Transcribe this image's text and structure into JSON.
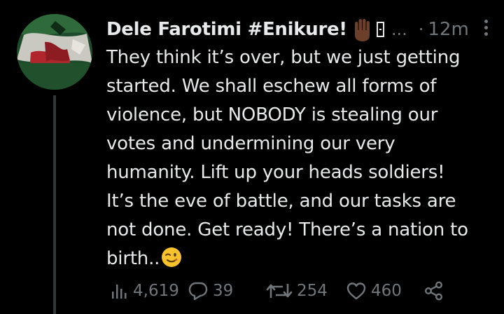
{
  "tweet": {
    "author_name": "Dele Farotimi #Enikure!",
    "ellipsis": "...",
    "separator": "·",
    "timestamp": "12m",
    "text_lines": [
      "They think it’s over, but we just getting",
      "started. We shall eschew all forms of",
      "violence, but NOBODY is stealing our",
      "votes and undermining our very",
      "humanity. Lift up your heads soldiers!",
      "It’s the eve of battle, and our tasks are",
      "not done. Get ready! There’s a nation to",
      "birth.."
    ],
    "emojis": [
      "raised-hand-dark-skin",
      "winking-face"
    ]
  },
  "actions": {
    "views": "4,619",
    "replies": "39",
    "retweets": "254",
    "likes": "460"
  },
  "icons": [
    "more-icon",
    "views-icon",
    "reply-icon",
    "retweet-icon",
    "like-icon",
    "share-icon"
  ],
  "colors": {
    "background": "#000000",
    "text_primary": "#e7e9ea",
    "text_secondary": "#71767b",
    "thread_line": "#333639"
  }
}
